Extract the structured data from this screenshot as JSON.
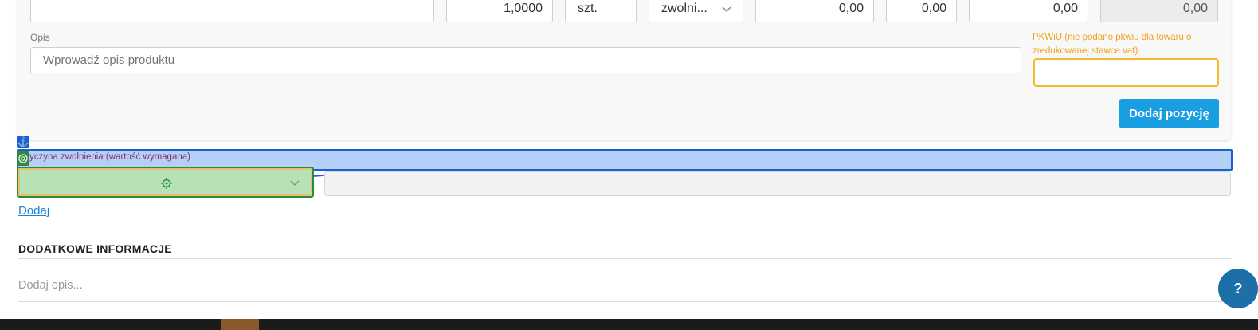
{
  "item_row": {
    "quantity": "1,0000",
    "unit": "szt.",
    "vat_select": "zwolni...",
    "net_price": "0,00",
    "discount": "0,00",
    "net_value": "0,00",
    "gross_value": "0,00"
  },
  "description": {
    "label": "Opis",
    "placeholder": "Wprowadź opis produktu"
  },
  "pkwiu": {
    "label": "PKWiU (nie podano pkwiu dla towaru o zredukowanej stawce vat)",
    "value": ""
  },
  "add_position_button": "Dodaj pozycję",
  "exemption": {
    "overlay_label": "yczyna zwolnienia (wartość wymagana)",
    "anchor_icon": "⚓",
    "select_value": "",
    "free_text": ""
  },
  "add_link": "Dodaj",
  "additional_info": {
    "title": "DODATKOWE INFORMACJE",
    "placeholder": "Dodaj opis..."
  },
  "help_button": "?",
  "colors": {
    "primary_button": "#1a9ee2",
    "warning": "#f0a21b",
    "overlay_blue": "#1a5fd6",
    "overlay_green": "#2e8b3e",
    "help_button": "#1d6fa8"
  }
}
